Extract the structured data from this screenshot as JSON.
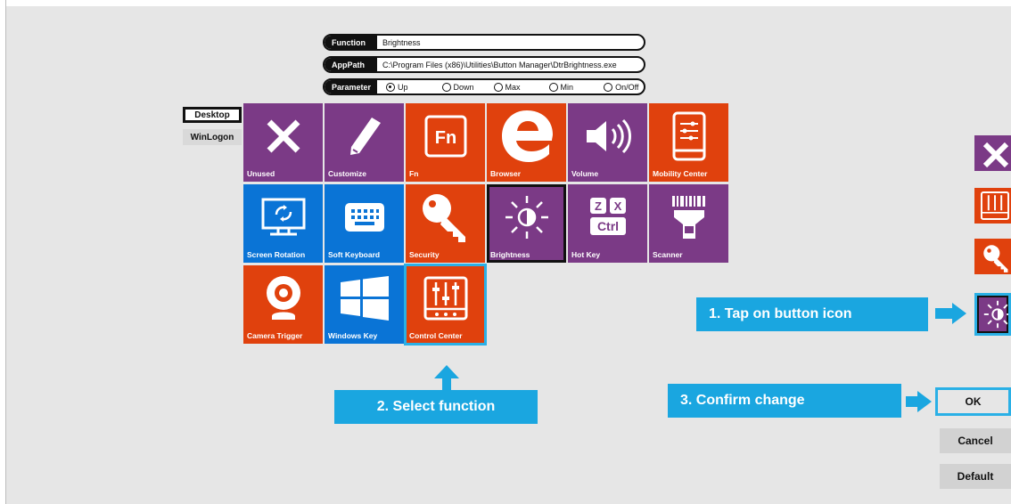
{
  "info": {
    "function_label": "Function",
    "function_value": "Brightness",
    "apppath_label": "AppPath",
    "apppath_value": "C:\\Program Files (x86)\\Utilities\\Button Manager\\DtrBrightness.exe",
    "parameter_label": "Parameter",
    "parameters": [
      {
        "label": "Up",
        "selected": true
      },
      {
        "label": "Down",
        "selected": false
      },
      {
        "label": "Max",
        "selected": false
      },
      {
        "label": "Min",
        "selected": false
      },
      {
        "label": "On/Off",
        "selected": false
      }
    ]
  },
  "side_tabs": [
    {
      "label": "Desktop",
      "active": true
    },
    {
      "label": "WinLogon",
      "active": false
    }
  ],
  "tiles": [
    {
      "label": "Unused",
      "icon": "x-icon",
      "color": "purple"
    },
    {
      "label": "Customize",
      "icon": "pencil-icon",
      "color": "purple"
    },
    {
      "label": "Fn",
      "icon": "fn-icon",
      "color": "orange"
    },
    {
      "label": "Browser",
      "icon": "edge-browser-icon",
      "color": "orange"
    },
    {
      "label": "Volume",
      "icon": "speaker-icon",
      "color": "purple"
    },
    {
      "label": "Mobility Center",
      "icon": "mobility-center-icon",
      "color": "orange"
    },
    {
      "label": "Screen Rotation",
      "icon": "screen-rotation-icon",
      "color": "blue"
    },
    {
      "label": "Soft Keyboard",
      "icon": "keyboard-icon",
      "color": "blue"
    },
    {
      "label": "Security",
      "icon": "key-icon",
      "color": "orange"
    },
    {
      "label": "Brightness",
      "icon": "brightness-icon",
      "color": "purple"
    },
    {
      "label": "Hot Key",
      "icon": "hot-key-icon",
      "color": "purple"
    },
    {
      "label": "Scanner",
      "icon": "barcode-scanner-icon",
      "color": "purple"
    },
    {
      "label": "Camera Trigger",
      "icon": "webcam-icon",
      "color": "orange"
    },
    {
      "label": "Windows Key",
      "icon": "windows-logo-icon",
      "color": "blue"
    },
    {
      "label": "Control Center",
      "icon": "sliders-icon",
      "color": "orange"
    }
  ],
  "fn_text": "Fn",
  "hotkey_keys": [
    "Z",
    "X",
    "Ctrl"
  ],
  "callouts": {
    "tap": "1. Tap on button icon",
    "select": "2. Select function",
    "confirm": "3. Confirm change"
  },
  "buttons": {
    "ok": "OK",
    "cancel": "Cancel",
    "default": "Default"
  },
  "colors": {
    "purple": "#7b3a86",
    "orange": "#e0410d",
    "blue": "#0a74d6",
    "callout": "#1aa6e0"
  }
}
